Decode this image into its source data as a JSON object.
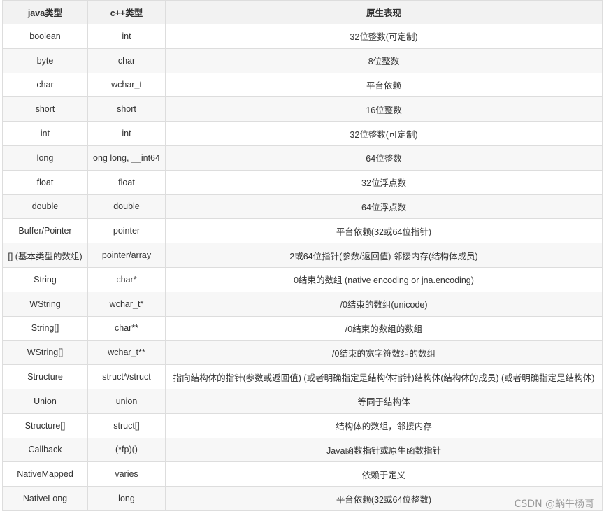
{
  "table": {
    "headers": [
      "java类型",
      "c++类型",
      "原生表现"
    ],
    "rows": [
      [
        "boolean",
        "int",
        "32位整数(可定制)"
      ],
      [
        "byte",
        "char",
        "8位整数"
      ],
      [
        "char",
        "wchar_t",
        "平台依赖"
      ],
      [
        "short",
        "short",
        "16位整数"
      ],
      [
        "int",
        "int",
        "32位整数(可定制)"
      ],
      [
        "long",
        "ong long, __int64",
        "64位整数"
      ],
      [
        "float",
        "float",
        "32位浮点数"
      ],
      [
        "double",
        "double",
        "64位浮点数"
      ],
      [
        "Buffer/Pointer",
        "pointer",
        "平台依赖(32或64位指针)"
      ],
      [
        "[] (基本类型的数组)",
        "pointer/array",
        "2或64位指针(参数/返回值) 邻接内存(结构体成员)"
      ],
      [
        "String",
        "char*",
        "0结束的数组 (native encoding or jna.encoding)"
      ],
      [
        "WString",
        "wchar_t*",
        "/0结束的数组(unicode)"
      ],
      [
        "String[]",
        "char**",
        "/0结束的数组的数组"
      ],
      [
        "WString[]",
        "wchar_t**",
        "/0结束的宽字符数组的数组"
      ],
      [
        "Structure",
        "struct*/struct",
        "指向结构体的指针(参数或返回值) (或者明确指定是结构体指针)结构体(结构体的成员) (或者明确指定是结构体)"
      ],
      [
        "Union",
        "union",
        "等同于结构体"
      ],
      [
        "Structure[]",
        "struct[]",
        "结构体的数组，邻接内存"
      ],
      [
        "Callback",
        "(*fp)()",
        "Java函数指针或原生函数指针"
      ],
      [
        "NativeMapped",
        "varies",
        "依赖于定义"
      ],
      [
        "NativeLong",
        "long",
        "平台依赖(32或64位整数)"
      ]
    ]
  },
  "watermark": "CSDN @蜗牛杨哥"
}
